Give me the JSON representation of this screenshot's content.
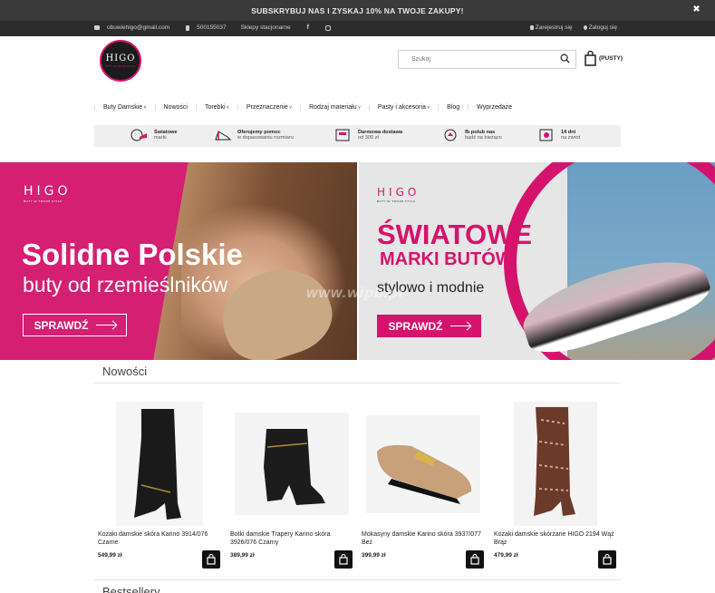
{
  "promo": {
    "text": "SUBSKRYBUJ NAS I ZYSKAJ 10% NA TWOJE ZAKUPY!",
    "close": "✖"
  },
  "topbar": {
    "email": "obuwiehigo@gmail.com",
    "phone": "500155037",
    "stores": "Sklepy stacjonarne",
    "register": "Zarejestruj się",
    "login": "Zaloguj się"
  },
  "header": {
    "logo_text": "HIGO",
    "logo_sub": "BUTY W TWOIM STYLU",
    "search_placeholder": "Szukaj",
    "cart_label": "(PUSTY)"
  },
  "nav": [
    "Buty Damskie",
    "Nowości",
    "Torebki",
    "Przeznaczenie",
    "Rodzaj materiału",
    "Pasty i akcesoria",
    "Blog",
    "Wyprzedaże"
  ],
  "features": [
    {
      "title": "Światowe",
      "sub": "marki",
      "icon": "shoe-hand-icon"
    },
    {
      "title": "Oferujemy pomoc",
      "sub": "w dopasowaniu rozmiaru",
      "icon": "heel-icon"
    },
    {
      "title": "Darmowa dostawa",
      "sub": "od 300 zł",
      "icon": "delivery-icon"
    },
    {
      "title": "fb polub nas",
      "sub": "bądź na bieżąco",
      "icon": "like-icon"
    },
    {
      "title": "14 dni",
      "sub": "na zwrot",
      "icon": "return-icon"
    }
  ],
  "banners": {
    "left": {
      "logo": "HIGO",
      "logo_sub": "BUTY W TWOIM STYLU",
      "headline": "Solidne Polskie",
      "subline": "buty od rzemieślników",
      "button": "SPRAWDŹ"
    },
    "right": {
      "logo": "HIGO",
      "logo_sub": "BUTY W TWOIM STYLU",
      "headline": "ŚWIATOWE",
      "subline": "MARKI BUTÓW",
      "tagline": "stylowo i modnie",
      "button": "SPRAWDŹ"
    },
    "watermark": "www.wipb.pl"
  },
  "sections": {
    "new": "Nowości",
    "bestsellers": "Bestsellery"
  },
  "products": [
    {
      "name": "Kozaki damskie skóra Karino 3914/076 Czarne",
      "price": "549,99 zł"
    },
    {
      "name": "Botki damskie Trapery Karino skóra 3926/076 Czarny",
      "price": "389,99 zł"
    },
    {
      "name": "Mokasyny damskie Karino skóra 3937/077 Beż",
      "price": "399,99 zł"
    },
    {
      "name": "Kozaki damskie skórzane HIGO 2194 Wąż Brąz",
      "price": "479,99 zł"
    }
  ],
  "colors": {
    "accent": "#d5136d",
    "dark": "#2c2c2c"
  }
}
